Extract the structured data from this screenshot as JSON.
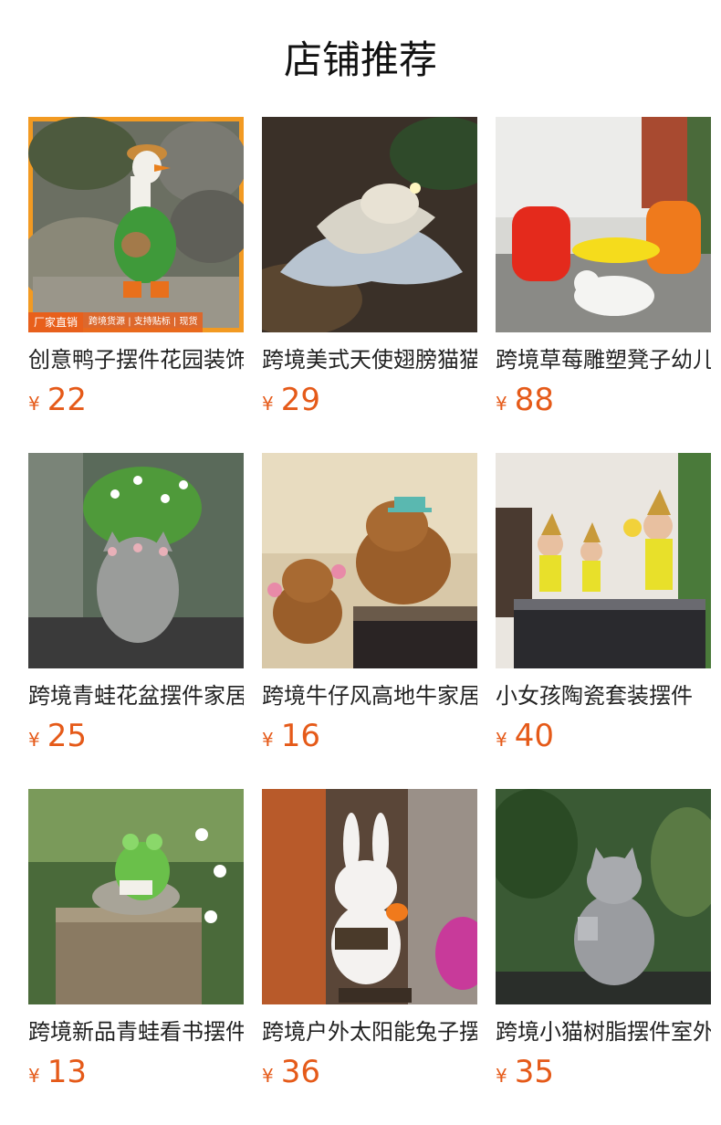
{
  "page_title": "店铺推荐",
  "colors": {
    "price": "#e55a19",
    "badge": "#e8601c"
  },
  "products": [
    {
      "name": "创意鸭子摆件花园装饰",
      "currency": "¥",
      "price": "22",
      "badge": "厂家直销",
      "badge_tags": "跨境货源 | 支持贴标 | 现货"
    },
    {
      "name": "跨境美式天使翅膀猫猫",
      "currency": "¥",
      "price": "29"
    },
    {
      "name": "跨境草莓雕塑凳子幼儿园",
      "currency": "¥",
      "price": "88"
    },
    {
      "name": "跨境青蛙花盆摆件家居",
      "currency": "¥",
      "price": "25"
    },
    {
      "name": "跨境牛仔风高地牛家居",
      "currency": "¥",
      "price": "16"
    },
    {
      "name": "小女孩陶瓷套装摆件",
      "currency": "¥",
      "price": "40"
    },
    {
      "name": "跨境新品青蛙看书摆件",
      "currency": "¥",
      "price": "13"
    },
    {
      "name": "跨境户外太阳能兔子摆件",
      "currency": "¥",
      "price": "36"
    },
    {
      "name": "跨境小猫树脂摆件室外",
      "currency": "¥",
      "price": "35"
    }
  ]
}
